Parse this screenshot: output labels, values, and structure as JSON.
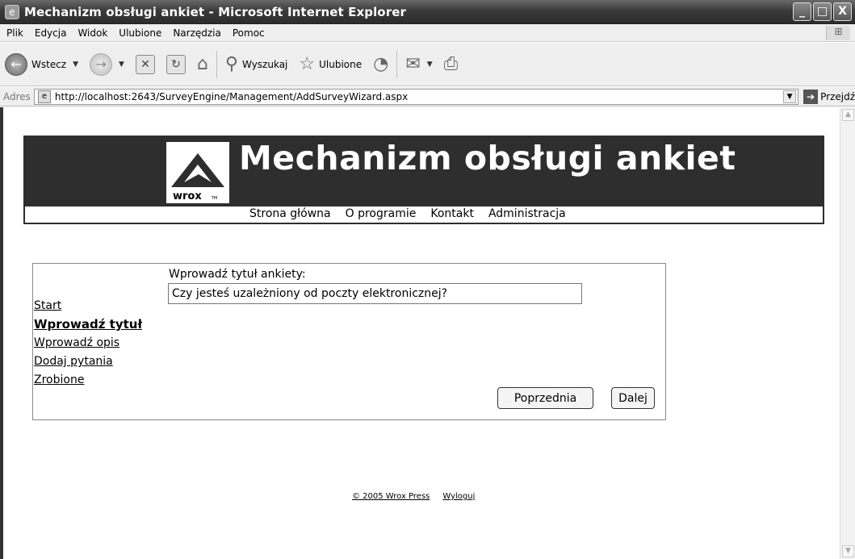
{
  "window": {
    "title": "Mechanizm obsługi ankiet - Microsoft Internet Explorer",
    "buttons": [
      "_",
      "□",
      "X"
    ]
  },
  "menu": {
    "items": [
      "Plik",
      "Edycja",
      "Widok",
      "Ulubione",
      "Narzędzia",
      "Pomoc"
    ]
  },
  "toolbar": {
    "back_label": "Wstecz",
    "search_label": "Wyszukaj",
    "favorites_label": "Ulubione"
  },
  "address": {
    "label": "Adres",
    "url": "http://localhost:2643/SurveyEngine/Management/AddSurveyWizard.aspx",
    "go_label": "Przejdź"
  },
  "site": {
    "title": "Mechanizm obsługi ankiet",
    "logo_text": "wrox",
    "logo_tm": "TM",
    "nav": [
      "Strona główna",
      "O programie",
      "Kontakt",
      "Administracja"
    ]
  },
  "wizard": {
    "steps": [
      {
        "label": "Start",
        "current": false
      },
      {
        "label": "Wprowadź tytuł",
        "current": true
      },
      {
        "label": "Wprowadź opis",
        "current": false
      },
      {
        "label": "Dodaj pytania",
        "current": false
      },
      {
        "label": "Zrobione",
        "current": false
      }
    ],
    "field_label": "Wprowadź tytuł ankiety:",
    "title_value": "Czy jesteś uzależniony od poczty elektronicznej?",
    "prev_button": "Poprzednia",
    "next_button": "Dalej"
  },
  "footer": {
    "copyright": "© 2005 Wrox Press",
    "logout": "Wyloguj"
  }
}
